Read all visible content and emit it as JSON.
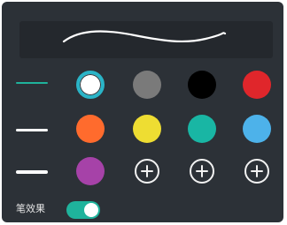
{
  "preview": {
    "label": "stroke-preview"
  },
  "stroke_widths": [
    {
      "name": "thin",
      "selected": true,
      "color": "#1fb39c"
    },
    {
      "name": "medium",
      "selected": false,
      "color": "#ffffff"
    },
    {
      "name": "thick",
      "selected": false,
      "color": "#ffffff"
    }
  ],
  "colors": [
    {
      "hex": "#ffffff",
      "selected": true
    },
    {
      "hex": "#7a7a7a",
      "selected": false
    },
    {
      "hex": "#000000",
      "selected": false
    },
    {
      "hex": "#e0262b",
      "selected": false
    },
    {
      "hex": "#ff6b2d",
      "selected": false
    },
    {
      "hex": "#eedd32",
      "selected": false
    },
    {
      "hex": "#19b6a4",
      "selected": false
    },
    {
      "hex": "#4db2ea",
      "selected": false
    },
    {
      "hex": "#a642a8",
      "selected": false
    }
  ],
  "add_buttons": [
    {
      "icon": "plus-icon"
    },
    {
      "icon": "plus-icon"
    },
    {
      "icon": "plus-icon"
    }
  ],
  "effect": {
    "label": "笔效果",
    "enabled": true,
    "accent": "#1fb39c"
  }
}
